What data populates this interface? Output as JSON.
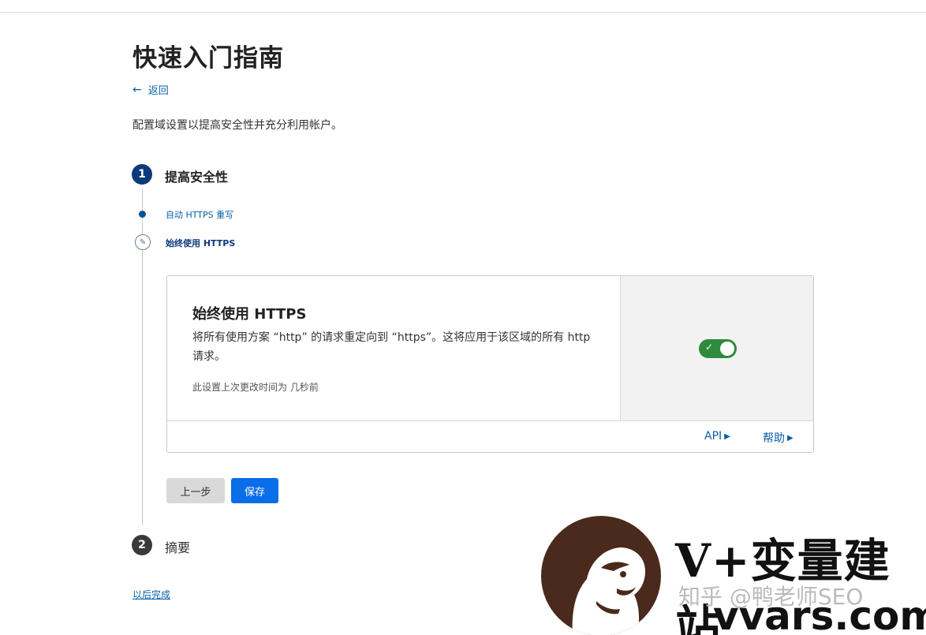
{
  "page": {
    "title": "快速入门指南",
    "back_label": "返回",
    "description": "配置域设置以提高安全性并充分利用帐户。"
  },
  "steps": [
    {
      "number": "1",
      "title": "提高安全性"
    },
    {
      "number": "2",
      "title": "摘要"
    }
  ],
  "substeps": [
    {
      "label": "自动 HTTPS 重写"
    },
    {
      "label": "始终使用 HTTPS"
    }
  ],
  "card": {
    "title": "始终使用 HTTPS",
    "description": "将所有使用方案 “http” 的请求重定向到 “https”。这将应用于该区域的所有 http 请求。",
    "meta": "此设置上次更改时间为 几秒前",
    "toggle_on": true,
    "api_label": "API",
    "help_label": "帮助"
  },
  "buttons": {
    "prev": "上一步",
    "save": "保存"
  },
  "later_label": "以后完成",
  "watermark": {
    "brand": "V+变量建站",
    "zhihu": "知乎 @鸭老师SEO",
    "url": "vvars.com"
  },
  "colors": {
    "link": "#0a5fa8",
    "step_active": "#0b3a7a",
    "toggle_on": "#2f8a3d",
    "primary_button": "#0a6ee8"
  }
}
